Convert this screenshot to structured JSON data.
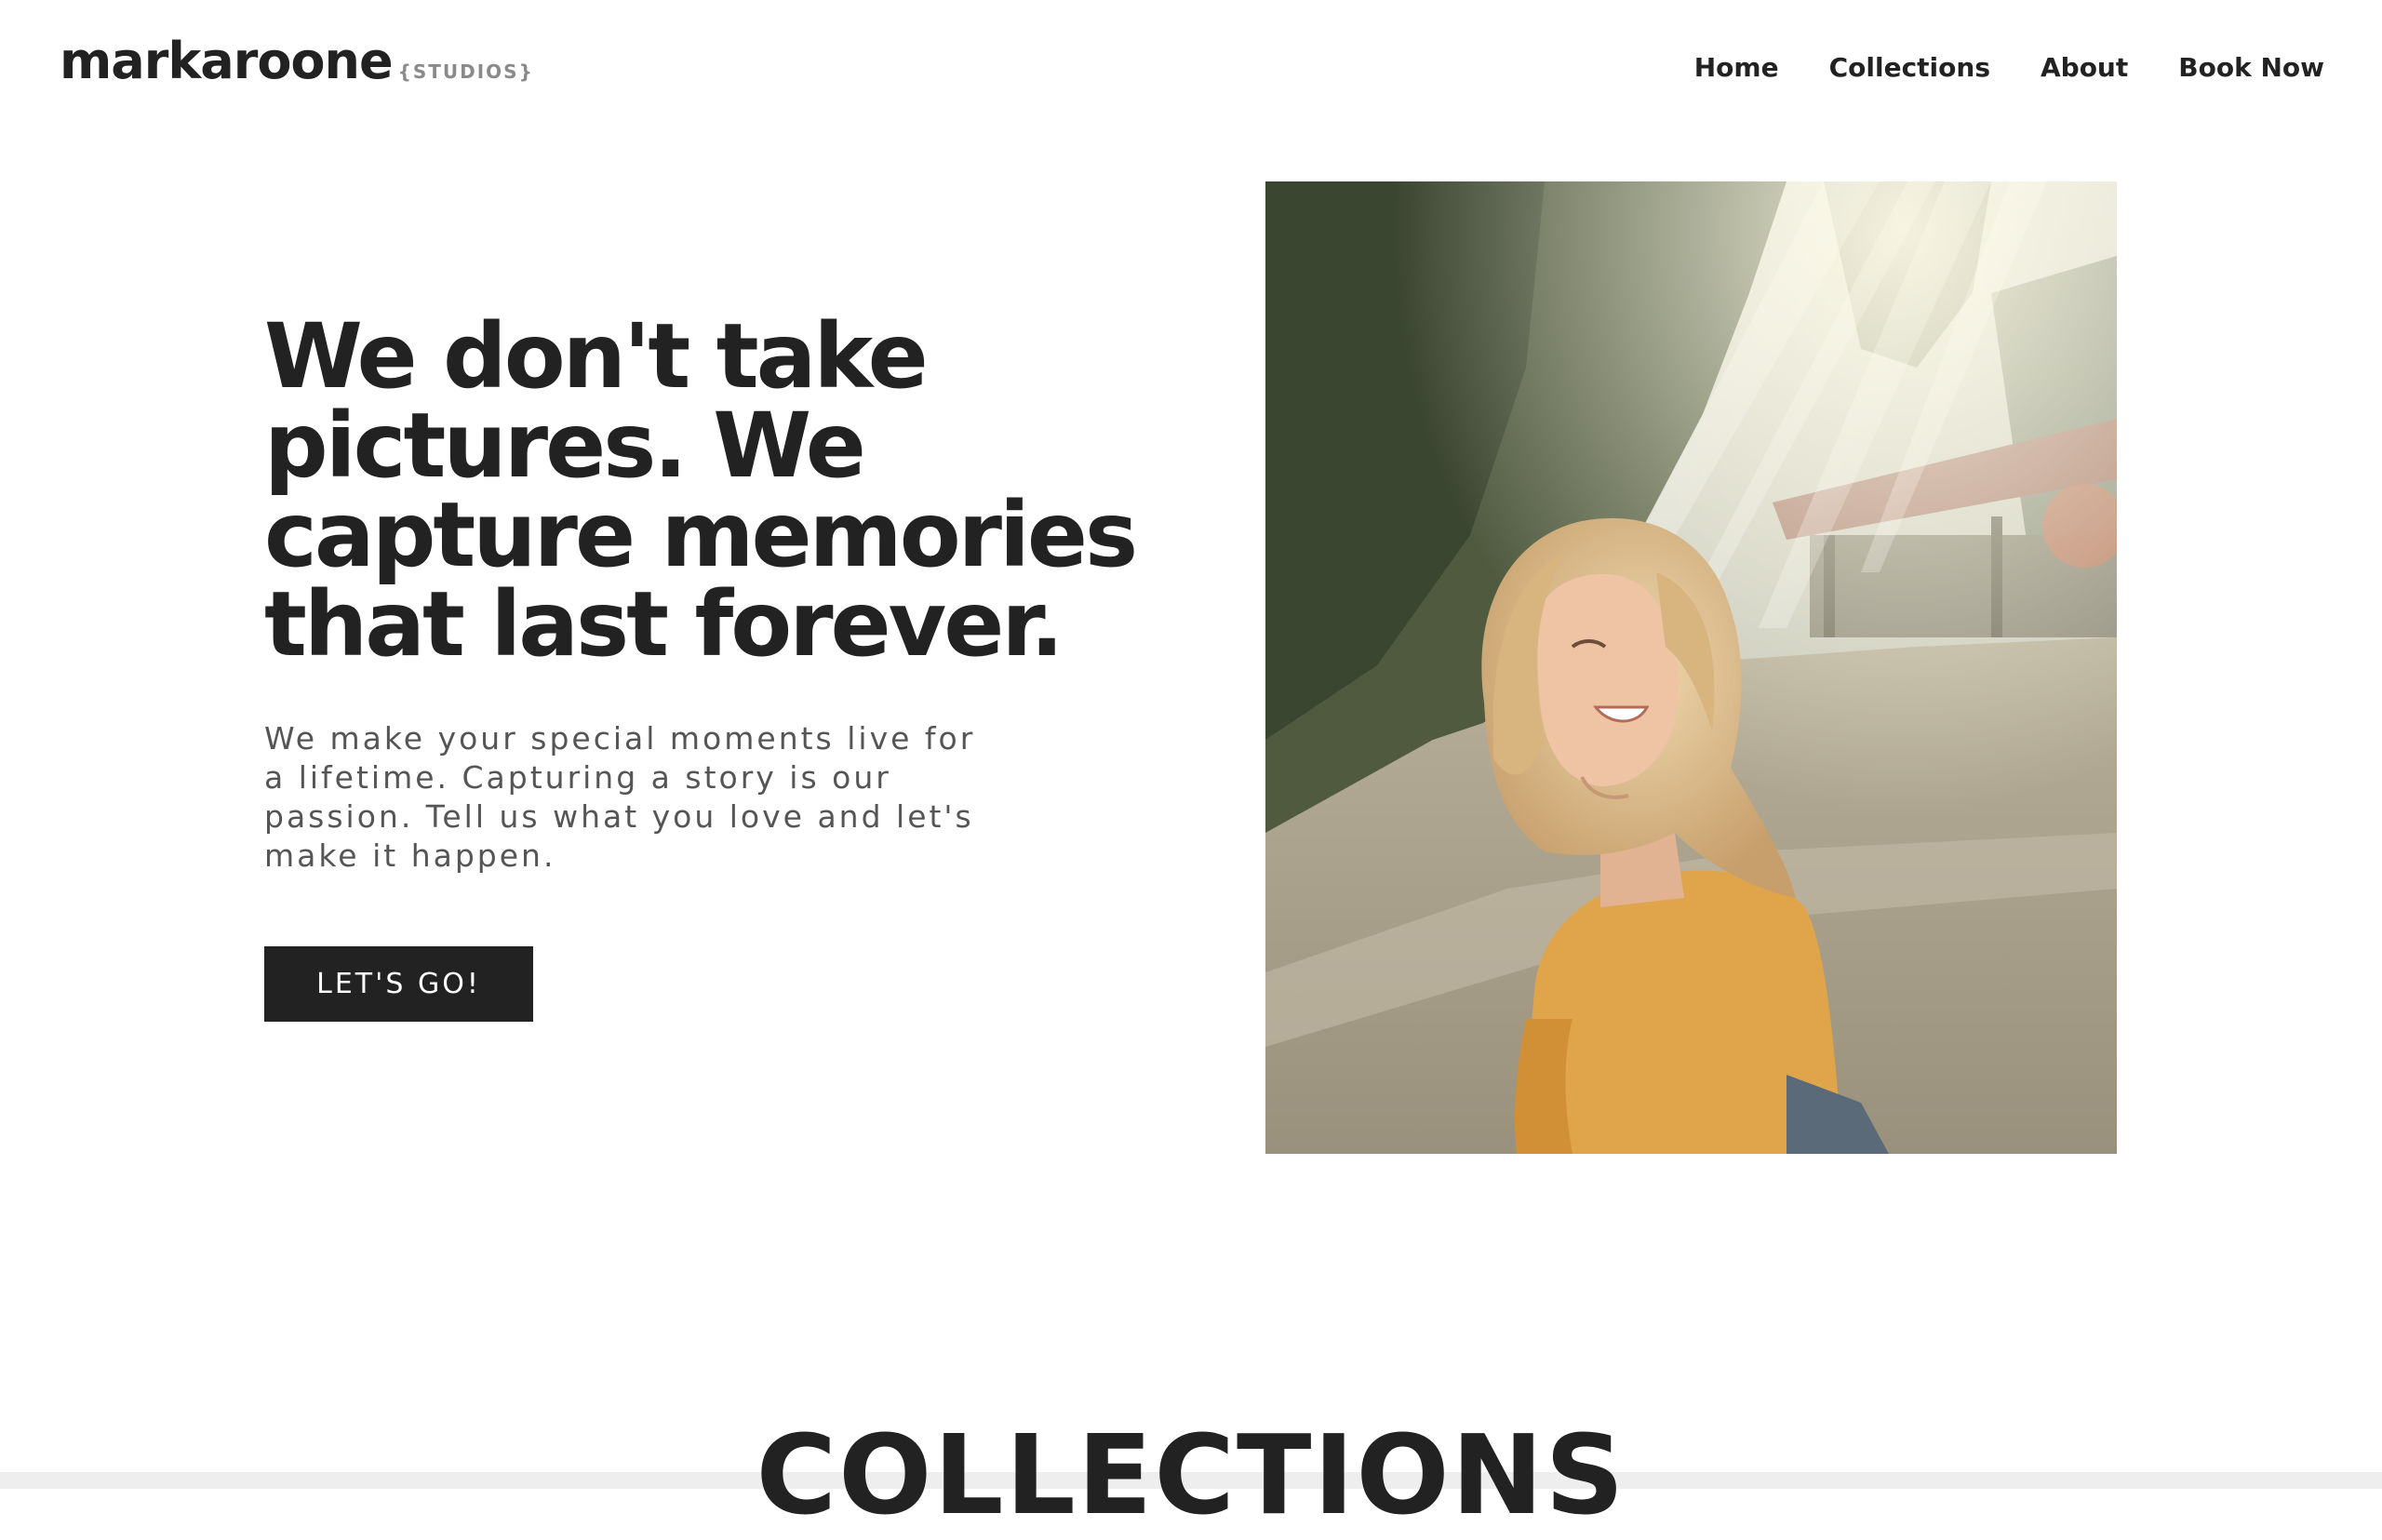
{
  "brand": {
    "name": "markaroone",
    "tag": "{STUDIOS}"
  },
  "nav": {
    "items": [
      {
        "label": "Home"
      },
      {
        "label": "Collections"
      },
      {
        "label": "About"
      },
      {
        "label": "Book Now"
      }
    ]
  },
  "hero": {
    "title": "We don't take pictures. We capture memories that last forever.",
    "subtitle": "We make your special moments live for a lifetime. Capturing a story is our passion. Tell us what you love and let's make it happen.",
    "cta_label": "LET'S GO!"
  },
  "photo": {
    "icon": "hero-photo-woman-in-sunlit-field"
  },
  "collections": {
    "title": "COLLECTIONS"
  },
  "colors": {
    "text": "#222222",
    "button_bg": "#222222",
    "button_text": "#ffffff",
    "muted": "#8a8a8a",
    "band": "#eeeeee"
  }
}
